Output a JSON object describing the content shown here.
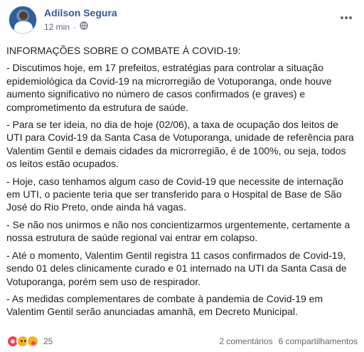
{
  "header": {
    "name": "Adilson Segura",
    "time": "12 min",
    "privacy_icon": "globe-icon",
    "more_icon": "more-options-icon"
  },
  "post": {
    "paragraphs": [
      "INFORMAÇÕES SOBRE O COMBATE À COVID-19:",
      "- Discutimos hoje, em 17 prefeitos, estratégias para controlar a situação epidemiológica da Covid-19 na microrregião de Votuporanga, onde houve aumento significativo no número de casos confirmados (e graves) e comprometimento da estrutura de saúde.",
      "- Para se ter ideia, no dia de hoje (02/06), a taxa de ocupação dos leitos de UTI para Covid-19 da Santa Casa de Votuporanga, unidade de referência para Valentim Gentil e demais cidades da microrregião, é de 100%, ou seja, todos os leitos estão ocupados.",
      "- Hoje, caso tenhamos algum caso de Covid-19 que necessite de internação em UTI, o paciente teria que ser transferido para o Hospital de Base de São José do Rio Preto, onde ainda há vagas.",
      "- Se não nos unirmos e não nos concientizarmos urgentemente, certamente a nossa estrutura de saúde regional vai entrar em colapso.",
      "- Até o momento, Valentim Gentil registra 11 casos confirmados de Covid-19, sendo 01 deles clinicamente curado e 01 internado na UTI da Santa Casa de Votuporanga, porém sem uso de respirador.",
      "- As medidas complementares de combate à pandemia de Covid-19 em Valentim Gentil serão anunciadas amanhã, em Decreto Municipal."
    ]
  },
  "footer": {
    "reaction_icons": [
      "love-reaction-icon",
      "sad-reaction-icon",
      "care-reaction-icon"
    ],
    "reaction_count": "25",
    "comments": "2 comentários",
    "shares": "6 compartilhamentos"
  }
}
